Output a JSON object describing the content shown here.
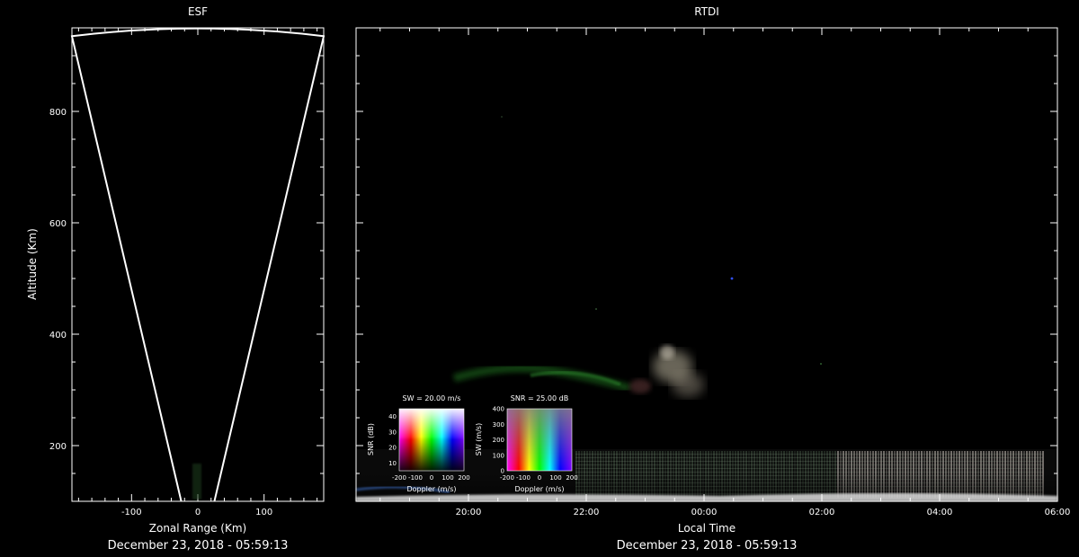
{
  "chart_data": [
    {
      "type": "line",
      "title": "ESF",
      "xlabel": "Zonal Range (Km)",
      "ylabel": "Altitude (Km)",
      "xlim": [
        -190,
        190
      ],
      "ylim": [
        100,
        950
      ],
      "x_ticks": [
        -100,
        0,
        100
      ],
      "y_ticks": [
        200,
        400,
        600,
        800
      ],
      "footer": "December 23, 2018 - 05:59:13",
      "outline": {
        "x": [
          -25,
          -190,
          -100,
          0,
          100,
          190,
          25
        ],
        "y": [
          100,
          935,
          945,
          950,
          945,
          935,
          100
        ]
      }
    },
    {
      "type": "heatmap",
      "title": "RTDI",
      "xlabel": "Local Time",
      "x_ticks": [
        "20:00",
        "22:00",
        "00:00",
        "02:00",
        "04:00",
        "06:00"
      ],
      "footer": "December 23, 2018 - 05:59:13",
      "legends": [
        {
          "title": "SW = 20.00 m/s",
          "xlabel": "Doppler (m/s)",
          "ylabel": "SNR (dB)",
          "x_ticks": [
            "-200",
            "-100",
            "0",
            "100",
            "200"
          ],
          "y_ticks": [
            "10",
            "20",
            "30",
            "40"
          ]
        },
        {
          "title": "SNR = 25.00 dB",
          "xlabel": "Doppler (m/s)",
          "ylabel": "SW (m/s)",
          "x_ticks": [
            "-200",
            "-100",
            "0",
            "100",
            "200"
          ],
          "y_ticks": [
            "0",
            "100",
            "200",
            "300",
            "400"
          ]
        }
      ]
    }
  ]
}
